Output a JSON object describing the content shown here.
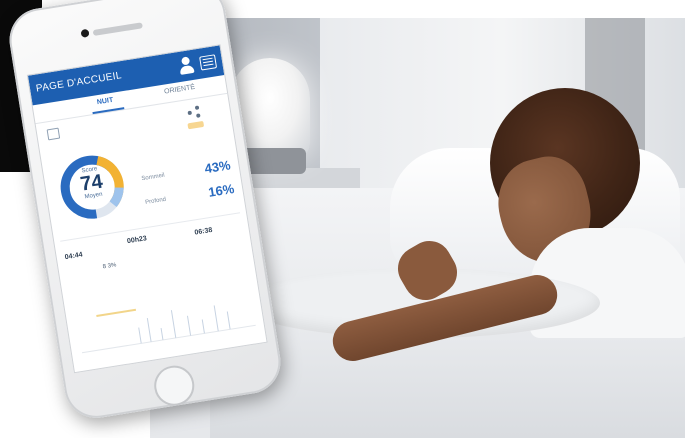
{
  "app": {
    "header_title": "PAGE D'ACCUEIL",
    "tabs": [
      {
        "label": "NUIT",
        "active": true
      },
      {
        "label": "ORIENTÉ",
        "active": false
      }
    ],
    "score_panel": {
      "label": "Score",
      "value": "74",
      "unit": "Moyen",
      "ring_colors": {
        "primary": "#2a6bc0",
        "accent": "#f2b233",
        "track": "#dfe6ef"
      }
    },
    "metrics": [
      {
        "label": "Sommeil",
        "value": "43%"
      },
      {
        "label": "Profond",
        "value": "16%"
      }
    ],
    "stats": [
      {
        "value": "04:44"
      },
      {
        "value": "00h23"
      },
      {
        "value": "06:38"
      },
      {
        "value": "8 3%"
      }
    ]
  },
  "colors": {
    "header_bg": "#1d5fb1",
    "accent_blue": "#2a6bc0",
    "accent_orange": "#e9a22a"
  }
}
